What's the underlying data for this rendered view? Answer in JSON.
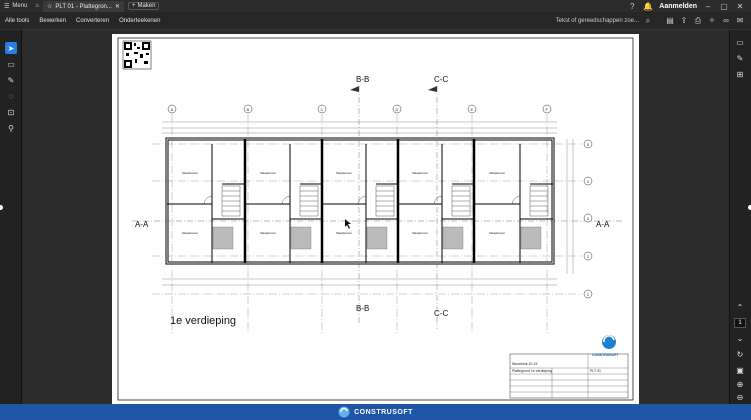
{
  "titlebar": {
    "menu_label": "Menu",
    "tab_title": "PLT 01 - Plattegron...",
    "new_tab_label": "Maken",
    "sign_in": "Aanmelden"
  },
  "menubar": {
    "items": [
      "Alle tools",
      "Bewerken",
      "Converteren",
      "Onderteekenen"
    ],
    "search_placeholder": "Tekst of gereedschappen zoe..."
  },
  "drawing": {
    "section_top_left": "B-B",
    "section_top_right": "C-C",
    "section_bottom_left": "B-B",
    "section_bottom_right": "C-C",
    "section_left": "A-A",
    "section_right": "A-A",
    "floor_label": "1e verdieping",
    "grid_top": [
      "A",
      "B",
      "C",
      "D",
      "E",
      "F"
    ],
    "grid_right": [
      "5",
      "4",
      "3",
      "2",
      "1"
    ],
    "room_label": "Slaapkamer"
  },
  "titleblock": {
    "brand": "CONSTRUSOFT",
    "project_name": "Woonblok 10-15",
    "sheet_title": "Plattegrond 1e verdieping",
    "sheet_number": "PLT 01"
  },
  "pagination": {
    "current_page": "1"
  },
  "footer": {
    "brand": "CONSTRUSOFT"
  },
  "colors": {
    "accent": "#2a7ee6",
    "footer_bg": "#1f56a8"
  }
}
